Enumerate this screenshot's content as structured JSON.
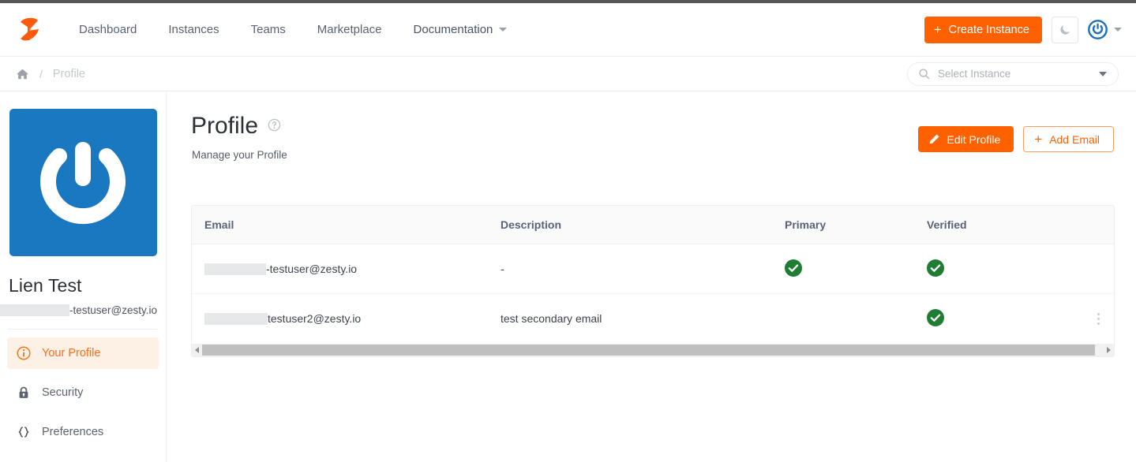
{
  "header": {
    "logo_alt": "Zesty logo",
    "nav": [
      {
        "label": "Dashboard"
      },
      {
        "label": "Instances"
      },
      {
        "label": "Teams"
      },
      {
        "label": "Marketplace"
      },
      {
        "label": "Documentation"
      }
    ],
    "create_instance_label": "Create Instance",
    "plus": "+",
    "theme_toggle": "dark-mode-moon-icon",
    "avatar": "user-power-avatar-icon"
  },
  "breadcrumb": {
    "home": "home-icon",
    "separator": "/",
    "current": "Profile"
  },
  "instance_search": {
    "placeholder": "Select Instance",
    "icon": "search-icon"
  },
  "sidebar": {
    "avatar_icon": "power-icon",
    "avatar_bg": "#1978bf",
    "user_name": "Lien Test",
    "user_email_visible": "-testuser@zesty.io",
    "items": [
      {
        "label": "Your Profile",
        "icon": "info-circle-icon",
        "active": true
      },
      {
        "label": "Security",
        "icon": "lock-icon",
        "active": false
      },
      {
        "label": "Preferences",
        "icon": "curly-braces-icon",
        "active": false
      }
    ],
    "accent": "#f4711c",
    "active_bg": "#fdf0e4"
  },
  "main": {
    "title": "Profile",
    "help_icon": "help-circle-icon",
    "subtitle": "Manage your Profile",
    "edit_profile_label": "Edit Profile",
    "add_email_label": "Add Email",
    "plus": "+",
    "edit_icon": "pencil-icon",
    "primary_color": "#ff6000"
  },
  "table": {
    "columns": [
      "Email",
      "Description",
      "Primary",
      "Verified",
      ""
    ],
    "rows": [
      {
        "email_visible": "-testuser@zesty.io",
        "email_redacted_width": 78,
        "description": "-",
        "primary": true,
        "verified": true,
        "menu": false
      },
      {
        "email_visible": "testuser2@zesty.io",
        "email_redacted_width": 80,
        "description": "test secondary email",
        "primary": false,
        "verified": true,
        "menu": true
      }
    ],
    "check_color": "#1e7d32"
  },
  "scrollbar": {
    "left_arrow": "scroll-left-arrow",
    "right_arrow": "scroll-right-arrow"
  }
}
